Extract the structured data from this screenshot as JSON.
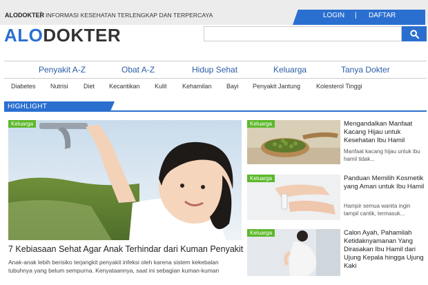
{
  "top": {
    "brand": "ALODOKTER",
    "separator": "|",
    "tagline": "INFORMASI KESEHATAN TERLENGKAP DAN TERPERCAYA",
    "login": "LOGIN",
    "auth_separator": "|",
    "daftar": "DAFTAR"
  },
  "logo": {
    "part1": "ALO",
    "part2": "DOKTER"
  },
  "search": {
    "placeholder": "",
    "icon": "search-icon"
  },
  "main_nav": [
    "Penyakit A-Z",
    "Obat A-Z",
    "Hidup Sehat",
    "Keluarga",
    "Tanya Dokter"
  ],
  "sub_nav": [
    "Diabetes",
    "Nutrisi",
    "Diet",
    "Kecantikan",
    "Kulit",
    "Kehamilan",
    "Bayi",
    "Penyakit Jantung",
    "Kolesterol Tinggi"
  ],
  "highlight": {
    "label": "HIGHLIGHT"
  },
  "hero": {
    "badge": "Keluarga",
    "title": "7 Kebiasaan Sehat Agar Anak Terhindar dari Kuman Penyakit",
    "desc": "Anak-anak lebih berisiko terjangkit penyakit infeksi oleh karena sistem kekebalan tubuhnya yang belum sempurna. Kenyataannya, saat ini sebagian kuman-kuman"
  },
  "cards": [
    {
      "badge": "Keluarga",
      "title": "Mengandalkan Manfaat Kacang Hijau untuk Kesehatan Ibu Hamil",
      "desc": "Manfaat kacang hijau untuk ibu hamil tidak..."
    },
    {
      "badge": "Keluarga",
      "title": "Panduan Memilih Kosmetik yang Aman untuk Ibu Hamil",
      "desc": "Hampir semua wanita ingin tampil cantik, termasuk..."
    },
    {
      "badge": "Keluarga",
      "title": "Calon Ayah, Pahamilah Ketidaknyamanan Yang Dirasakan Ibu Hamil dari Ujung Kepala hingga Ujung Kaki",
      "desc": ""
    }
  ],
  "colors": {
    "brand_blue": "#2a6fd0",
    "badge_green": "#5cb82a",
    "nav_blue": "#2a5ca8"
  }
}
